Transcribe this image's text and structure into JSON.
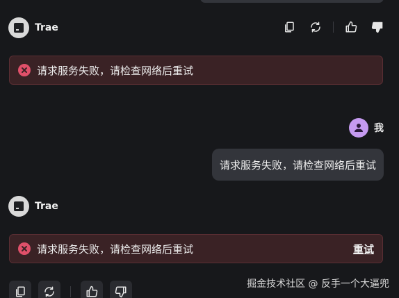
{
  "bot": {
    "name": "Trae"
  },
  "user": {
    "name": "我"
  },
  "errors": {
    "message_1": "请求服务失败，请检查网络后重试",
    "message_2": "请求服务失败，请检查网络后重试",
    "retry_label": "重试"
  },
  "user_message": "请求服务失败，请检查网络后重试",
  "watermark": "掘金技术社区 @ 反手一个大逼兜",
  "icons": {
    "copy": "copy-icon",
    "regenerate": "refresh-icon",
    "like": "thumbs-up-icon",
    "dislike": "thumbs-down-icon",
    "error": "error-x-icon",
    "user_avatar": "person-icon"
  },
  "colors": {
    "background": "#17181b",
    "error_bg": "#3a2225",
    "error_border": "#5a2e33",
    "error_icon": "#e0506a",
    "user_avatar": "#c59af0",
    "bubble": "#33353b"
  }
}
